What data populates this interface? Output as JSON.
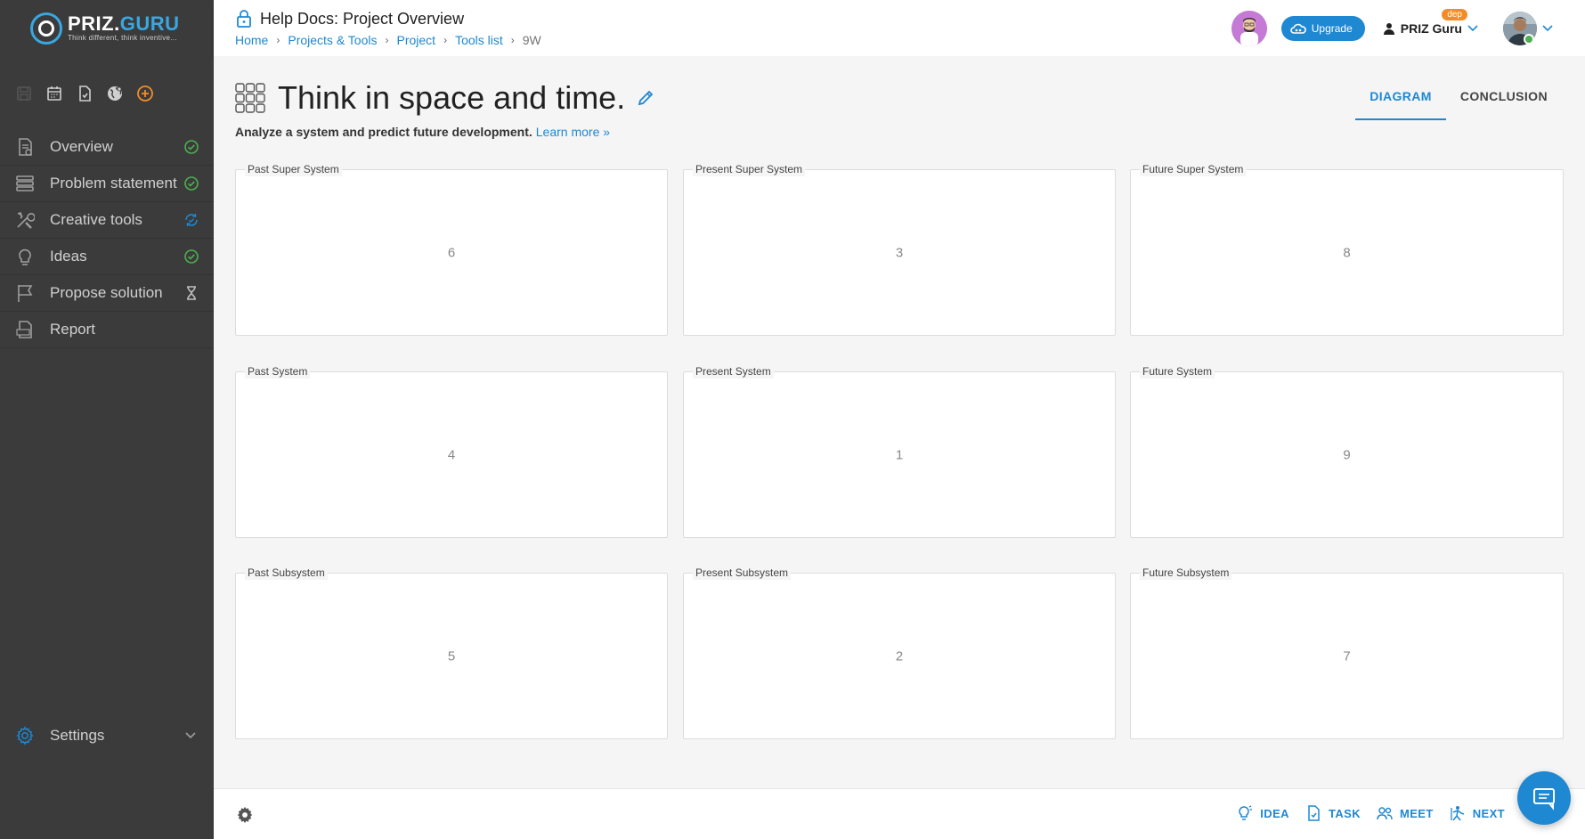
{
  "brand": {
    "name_part1": "PRIZ.",
    "name_part2": "GURU",
    "tagline": "Think different, think inventive..."
  },
  "quick_icons": [
    "save-icon",
    "calendar-icon",
    "task-icon",
    "globe-icon",
    "add-icon"
  ],
  "sidebar": {
    "items": [
      {
        "label": "Overview",
        "icon": "overview-icon",
        "status": "completed"
      },
      {
        "label": "Problem statement",
        "icon": "list-icon",
        "status": "completed"
      },
      {
        "label": "Creative tools",
        "icon": "tools-icon",
        "status": "in-progress"
      },
      {
        "label": "Ideas",
        "icon": "lightbulb-icon",
        "status": "completed"
      },
      {
        "label": "Propose solution",
        "icon": "flag-icon",
        "status": "pending"
      },
      {
        "label": "Report",
        "icon": "pdf-icon",
        "status": ""
      }
    ],
    "settings_label": "Settings"
  },
  "header": {
    "title": "Help Docs: Project Overview",
    "breadcrumb": [
      "Home",
      "Projects & Tools",
      "Project",
      "Tools list"
    ],
    "breadcrumb_current": "9W",
    "upgrade_label": "Upgrade",
    "user_name": "PRIZ Guru",
    "badge": "dep"
  },
  "page": {
    "title": "Think in space and time.",
    "subtitle": "Analyze a system and predict future development.",
    "learn_more": "Learn more »",
    "tabs": [
      {
        "label": "DIAGRAM",
        "active": true
      },
      {
        "label": "CONCLUSION",
        "active": false
      }
    ]
  },
  "grid": [
    {
      "label": "Past Super System",
      "value": "6"
    },
    {
      "label": "Present Super System",
      "value": "3"
    },
    {
      "label": "Future Super System",
      "value": "8"
    },
    {
      "label": "Past System",
      "value": "4"
    },
    {
      "label": "Present System",
      "value": "1"
    },
    {
      "label": "Future System",
      "value": "9"
    },
    {
      "label": "Past Subsystem",
      "value": "5"
    },
    {
      "label": "Present Subsystem",
      "value": "2"
    },
    {
      "label": "Future Subsystem",
      "value": "7"
    }
  ],
  "footer": {
    "actions": [
      "IDEA",
      "TASK",
      "MEET",
      "NEXT"
    ]
  },
  "colors": {
    "accent": "#1e88d2",
    "sidebar_bg": "#3b3b3b",
    "success": "#4caf50",
    "badge": "#f28c28"
  }
}
